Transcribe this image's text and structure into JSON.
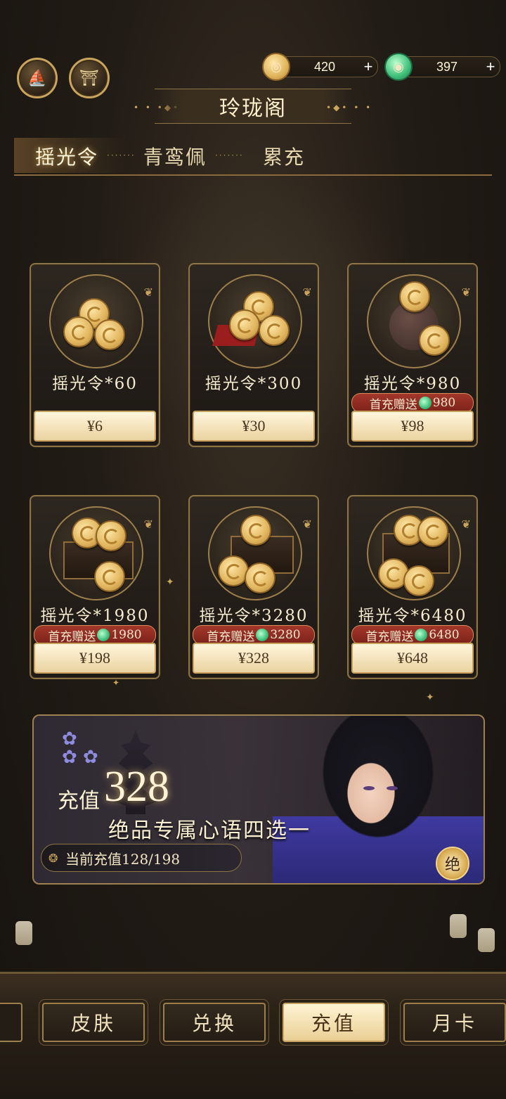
{
  "header": {
    "left_icons": [
      {
        "name": "boat-leaf-icon",
        "glyph": "⛵"
      },
      {
        "name": "pavilion-icon",
        "glyph": "⛩"
      }
    ],
    "currencies": [
      {
        "name": "yaoguang-token",
        "value": "420",
        "plus": "+"
      },
      {
        "name": "jade-pendant",
        "value": "397",
        "plus": "+"
      }
    ],
    "title": "玲珑阁",
    "title_deco_left": "• • •◆•",
    "title_deco_right": "•◆• • •"
  },
  "tabs": [
    {
      "label": "摇光令",
      "active": true
    },
    {
      "label": "青鸾佩",
      "active": false
    },
    {
      "label": "累充",
      "active": false
    }
  ],
  "tab_dots": "·······",
  "products": [
    {
      "name": "摇光令*60",
      "bonus": null,
      "price": "¥6"
    },
    {
      "name": "摇光令*300",
      "bonus": null,
      "price": "¥30"
    },
    {
      "name": "摇光令*980",
      "bonus": {
        "label": "首充赠送",
        "amount": "980"
      },
      "price": "¥98"
    },
    {
      "name": "摇光令*1980",
      "bonus": {
        "label": "首充赠送",
        "amount": "1980"
      },
      "price": "¥198"
    },
    {
      "name": "摇光令*3280",
      "bonus": {
        "label": "首充赠送",
        "amount": "3280"
      },
      "price": "¥328"
    },
    {
      "name": "摇光令*6480",
      "bonus": {
        "label": "首充赠送",
        "amount": "6480"
      },
      "price": "¥648"
    }
  ],
  "banner": {
    "prefix": "充值",
    "amount": "328",
    "subtitle": "绝品专属心语四选一",
    "progress": "当前充值128/198",
    "badge": "绝"
  },
  "bottom_nav": [
    {
      "label": "皮肤",
      "active": false
    },
    {
      "label": "兑换",
      "active": false
    },
    {
      "label": "充值",
      "active": true
    },
    {
      "label": "月卡",
      "active": false
    }
  ]
}
